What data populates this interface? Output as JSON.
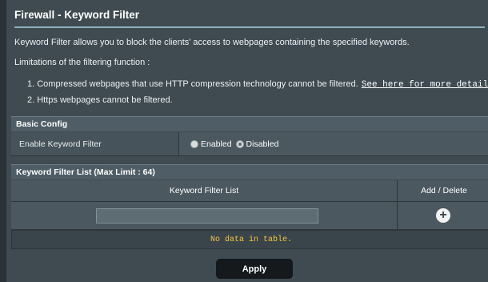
{
  "page": {
    "title": "Firewall - Keyword Filter",
    "description": "Keyword Filter allows you to block the clients' access to webpages containing the specified keywords.",
    "limitations_heading": "Limitations of the filtering function :",
    "limitation_1": "1. Compressed webpages that use HTTP compression technology cannot be filtered.",
    "limitation_1_link": "See here for more details.",
    "limitation_2": "2. Https webpages cannot be filtered."
  },
  "basic_config": {
    "header": "Basic Config",
    "enable_label": "Enable Keyword Filter",
    "option_enabled": "Enabled",
    "option_disabled": "Disabled",
    "selected": "Disabled"
  },
  "keyword_list": {
    "header": "Keyword Filter List (Max Limit : 64)",
    "col_keyword": "Keyword Filter List",
    "col_add_delete": "Add / Delete",
    "input_value": "",
    "empty_text": "No data in table."
  },
  "actions": {
    "apply_label": "Apply"
  },
  "colors": {
    "background": "#3f4b51",
    "empty_text": "#f5c542",
    "apply_button": "#15191c"
  }
}
